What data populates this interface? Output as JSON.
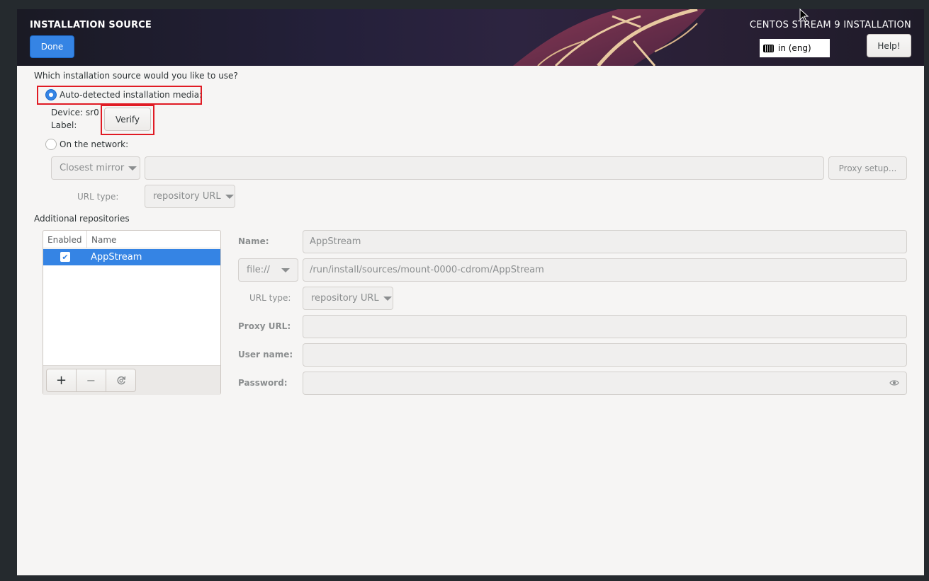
{
  "header": {
    "title": "INSTALLATION SOURCE",
    "done_label": "Done",
    "product": "CENTOS STREAM 9 INSTALLATION",
    "keyboard_layout": "in (eng)",
    "help_label": "Help!"
  },
  "source": {
    "question": "Which installation source would you like to use?",
    "auto_label": "Auto-detected installation media:",
    "auto_selected": true,
    "device_label": "Device: sr0",
    "label_label": "Label:",
    "verify_label": "Verify",
    "network_label": "On the network:",
    "mirror_value": "Closest mirror",
    "url_value": "",
    "proxy_setup_label": "Proxy setup...",
    "url_type_label": "URL type:",
    "url_type_value": "repository URL"
  },
  "repos": {
    "section_title": "Additional repositories",
    "col_enabled": "Enabled",
    "col_name": "Name",
    "rows": [
      {
        "enabled": true,
        "name": "AppStream"
      }
    ],
    "add_label": "+",
    "remove_label": "−",
    "reset_icon": "refresh-icon"
  },
  "repo_detail": {
    "name_label": "Name:",
    "name_value": "AppStream",
    "protocol_value": "file://",
    "path_value": "/run/install/sources/mount-0000-cdrom/AppStream",
    "url_type_label": "URL type:",
    "url_type_value": "repository URL",
    "proxy_label": "Proxy URL:",
    "proxy_value": "",
    "user_label": "User name:",
    "user_value": "",
    "password_label": "Password:",
    "password_value": ""
  },
  "colors": {
    "accent": "#3584e4",
    "highlight": "#e01b24"
  }
}
